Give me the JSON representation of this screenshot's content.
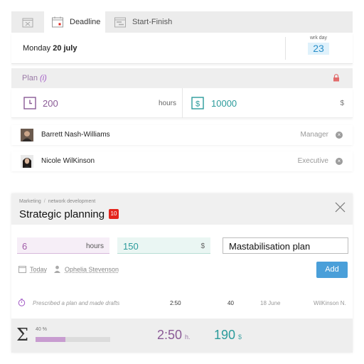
{
  "tabs": {
    "deadline_label": "Deadline",
    "startfinish_label": "Start-Finish"
  },
  "date": {
    "weekday": "Monday",
    "date": "20 july",
    "wrk_day_caption": "wrk day",
    "wrk_day_value": "23"
  },
  "plan": {
    "title": "Plan",
    "info": "(i)",
    "hours_value": "200",
    "hours_unit": "hours",
    "money_value": "10000",
    "money_unit": "$"
  },
  "people": [
    {
      "name": "Barrett Nash-Williams",
      "role": "Manager"
    },
    {
      "name": "Nicole WilKinson",
      "role": "Executive"
    }
  ],
  "task": {
    "breadcrumb": [
      "Marketing",
      "network development"
    ],
    "title": "Strategic planning",
    "badge": "10",
    "hours_value": "6",
    "hours_unit": "hours",
    "money_value": "150",
    "money_unit": "$",
    "name_value": "Mastabilisation plan",
    "date_link": "Today",
    "user_link": "Ophelia Stevenson",
    "add_label": "Add"
  },
  "log": {
    "description": "Prescribed a plan and made drafts",
    "time": "2:50",
    "count": "40",
    "date": "18 June",
    "who": "WilKinson N."
  },
  "summary": {
    "sigma": "Σ",
    "progress_label": "40 %",
    "progress": 0.4,
    "time": "2:50",
    "time_unit": "h.",
    "money": "190",
    "money_unit": "$"
  },
  "colors": {
    "hours_accent": "#8a5a96",
    "money_accent": "#2b9b9b",
    "button": "#4a9fd9",
    "badge": "#e3241b"
  }
}
